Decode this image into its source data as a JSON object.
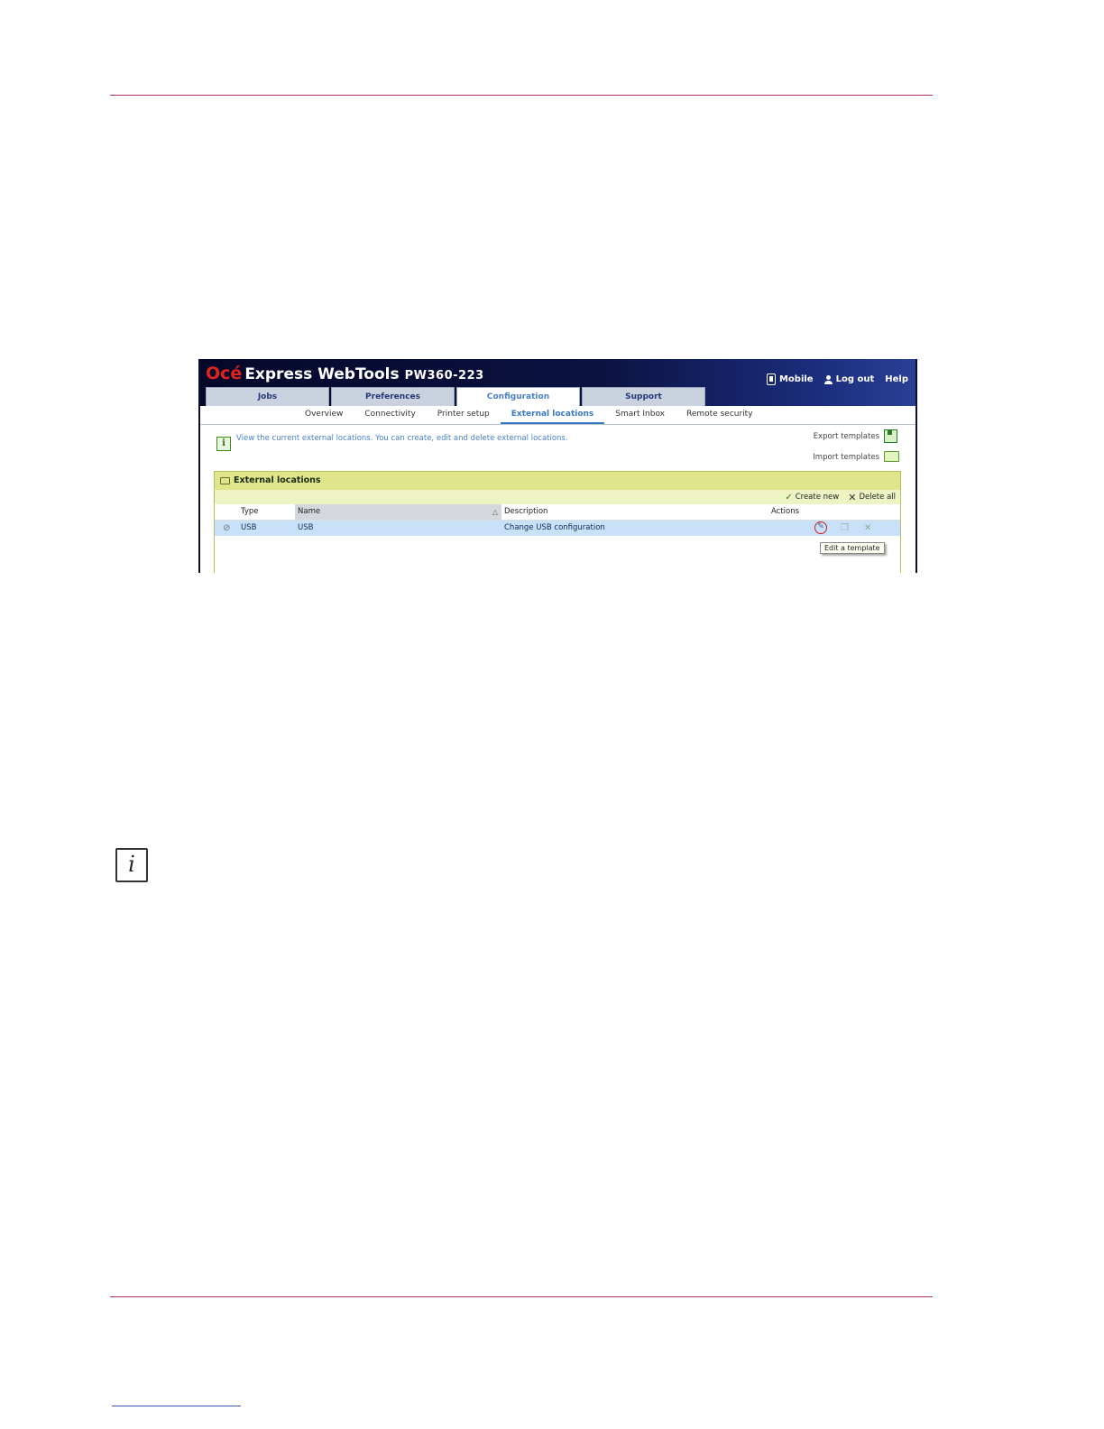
{
  "screenshot": {
    "brand": {
      "logo": "Océ",
      "product": "Express WebTools",
      "model": "PW360-223"
    },
    "top_links": {
      "mobile": "Mobile",
      "logout": "Log out",
      "help": "Help"
    },
    "tabs": [
      {
        "label": "Jobs",
        "active": false
      },
      {
        "label": "Preferences",
        "active": false
      },
      {
        "label": "Configuration",
        "active": true
      },
      {
        "label": "Support",
        "active": false
      }
    ],
    "subnav": [
      {
        "label": "Overview",
        "active": false
      },
      {
        "label": "Connectivity",
        "active": false
      },
      {
        "label": "Printer setup",
        "active": false
      },
      {
        "label": "External locations",
        "active": true
      },
      {
        "label": "Smart Inbox",
        "active": false
      },
      {
        "label": "Remote security",
        "active": false
      }
    ],
    "info_text": "View the current external locations. You can create, edit and delete external locations.",
    "templates": {
      "export": "Export templates",
      "import": "Import templates"
    },
    "panel": {
      "title": "External locations",
      "toolbar": {
        "create": "Create new",
        "delete_all": "Delete all"
      },
      "columns": [
        "Type",
        "Name",
        "Description",
        "Actions"
      ],
      "rows": [
        {
          "type": "USB",
          "name": "USB",
          "description": "Change USB configuration"
        }
      ]
    },
    "tooltip": "Edit a template"
  },
  "note_icon_glyph": "i",
  "colors": {
    "rule": "#b0306a",
    "header_dark": "#06082a",
    "brand_red": "#e0231c",
    "panel_header": "#dfe58a",
    "selected_row": "#c8e0f8"
  }
}
